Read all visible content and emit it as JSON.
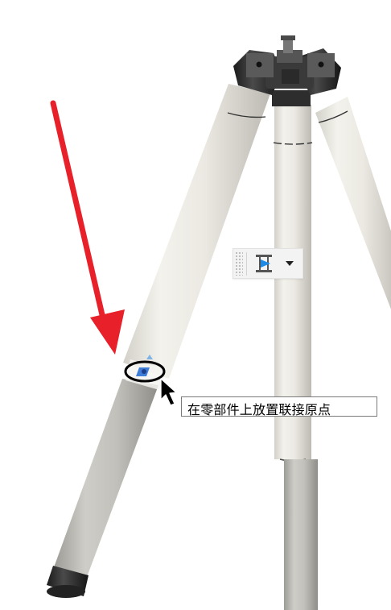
{
  "canvas": {
    "background": "#ffffff",
    "model": "tripod"
  },
  "mini_toolbar": {
    "primary_icon": "joint-icon",
    "dropdown_icon": "chevron-down-icon"
  },
  "annotation": {
    "icon": "red-arrow-icon",
    "color": "#e8202a"
  },
  "snap": {
    "icon": "joint-origin-snap-icon"
  },
  "cursor": {
    "icon": "mouse-pointer-icon"
  },
  "tooltip": {
    "text": "在零部件上放置联接原点"
  }
}
